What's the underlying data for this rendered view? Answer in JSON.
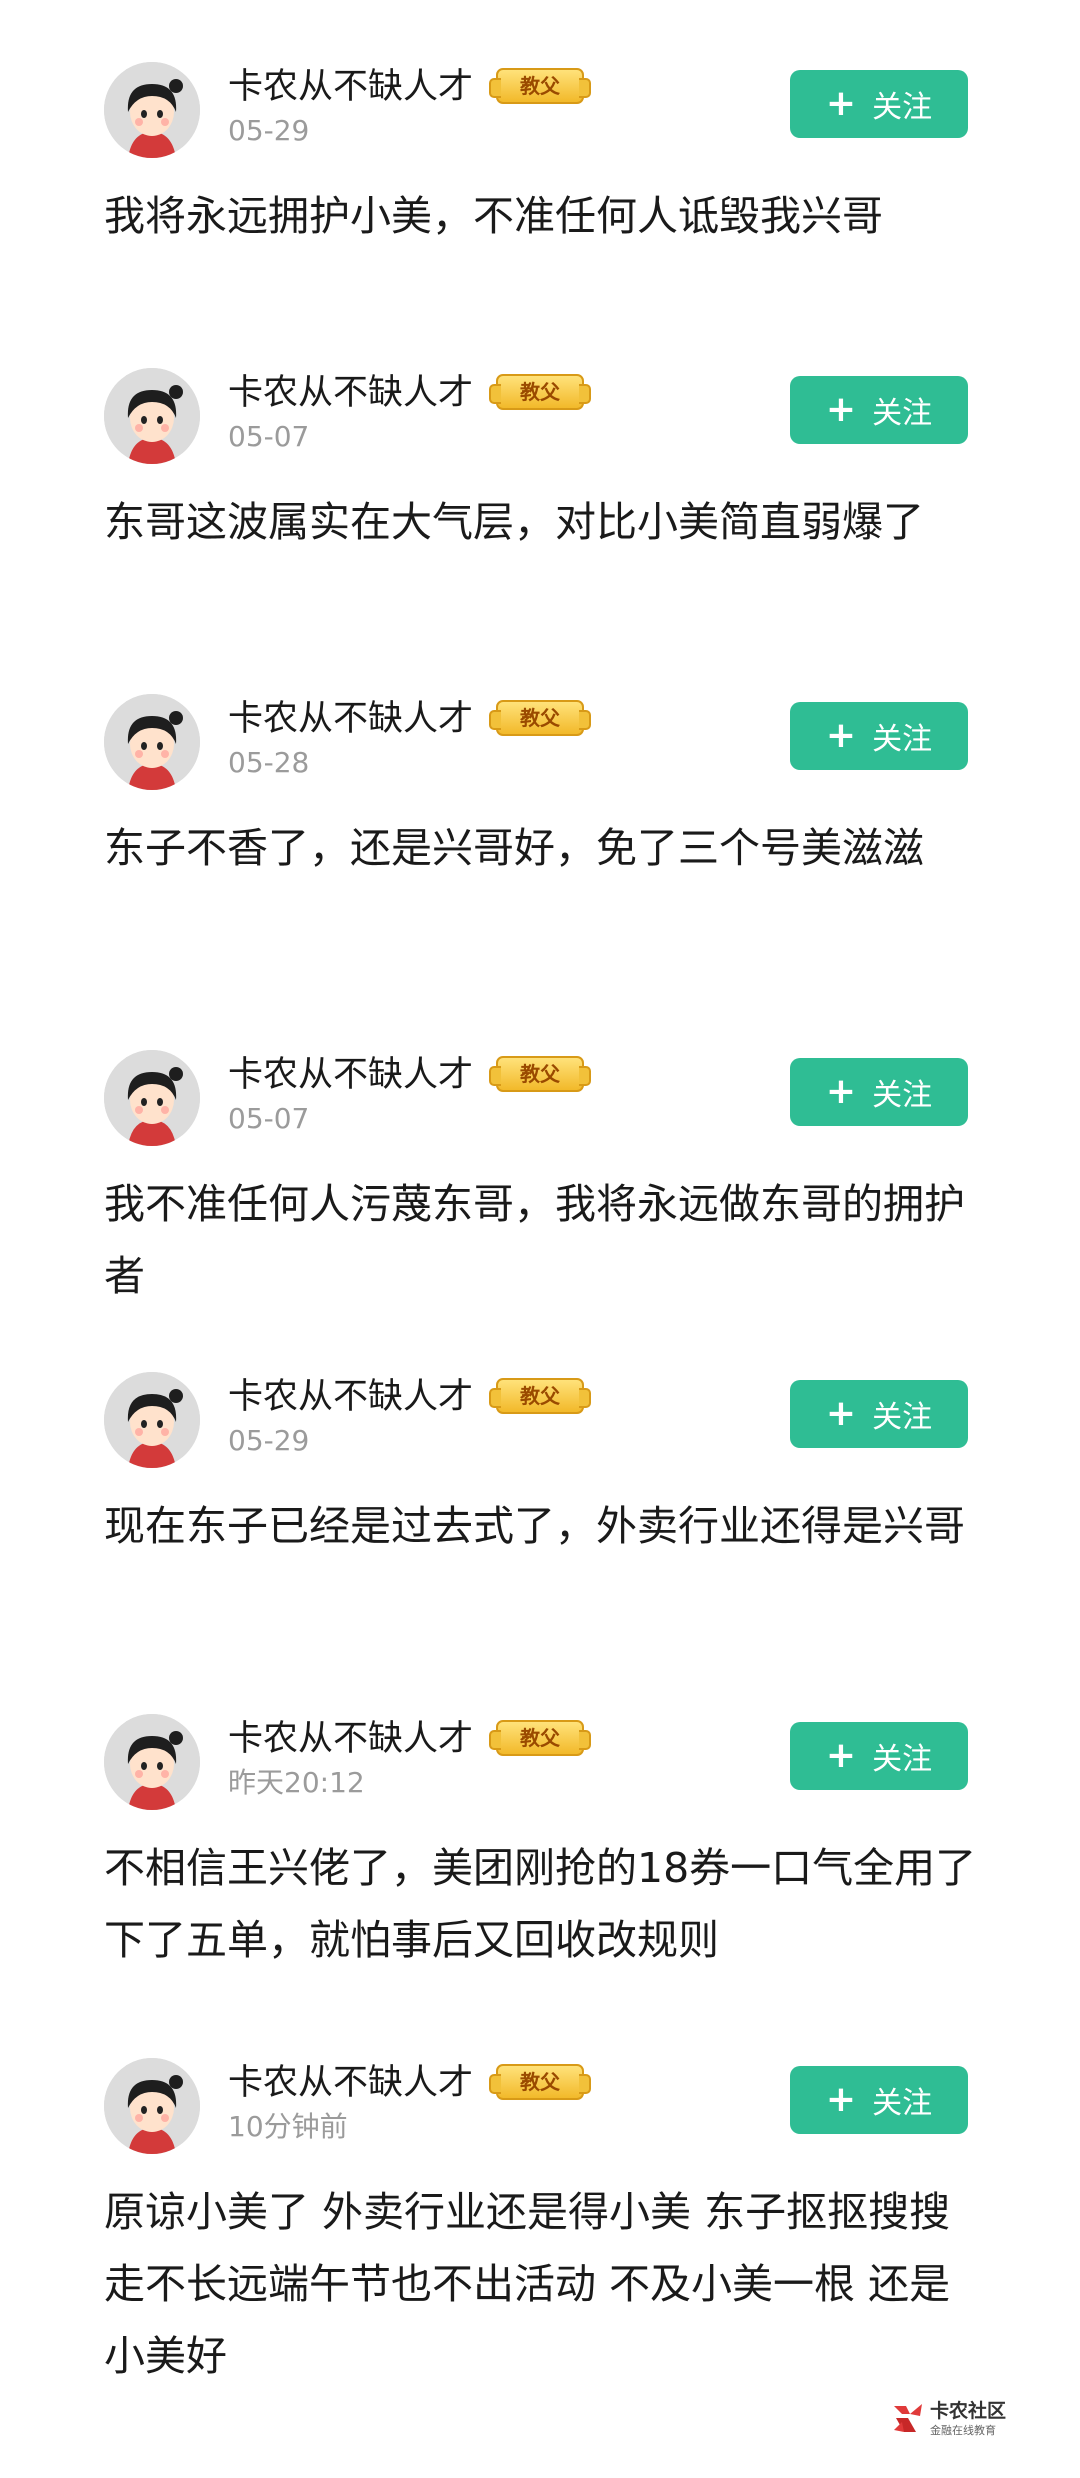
{
  "follow_label": "关注",
  "posts": [
    {
      "username": "卡农从不缺人才",
      "badge": "教父",
      "date": "05-29",
      "text": "我将永远拥护小美，不准任何人诋毁我兴哥"
    },
    {
      "username": "卡农从不缺人才",
      "badge": "教父",
      "date": "05-07",
      "text": "东哥这波属实在大气层，对比小美简直弱爆了"
    },
    {
      "username": "卡农从不缺人才",
      "badge": "教父",
      "date": "05-28",
      "text": "东子不香了，还是兴哥好，免了三个号美滋滋"
    },
    {
      "username": "卡农从不缺人才",
      "badge": "教父",
      "date": "05-07",
      "text": "我不准任何人污蔑东哥，我将永远做东哥的拥护者"
    },
    {
      "username": "卡农从不缺人才",
      "badge": "教父",
      "date": "05-29",
      "text": "现在东子已经是过去式了，外卖行业还得是兴哥"
    },
    {
      "username": "卡农从不缺人才",
      "badge": "教父",
      "date": "昨天20:12",
      "text": "不相信王兴佬了，美团刚抢的18券一口气全用了下了五单，就怕事后又回收改规则"
    },
    {
      "username": "卡农从不缺人才",
      "badge": "教父",
      "date": "10分钟前",
      "text": "原谅小美了 外卖行业还是得小美 东子抠抠搜搜走不长远端午节也不出活动 不及小美一根 还是小美好"
    }
  ],
  "watermark": {
    "title": "卡农社区",
    "subtitle": "金融在线教育"
  }
}
